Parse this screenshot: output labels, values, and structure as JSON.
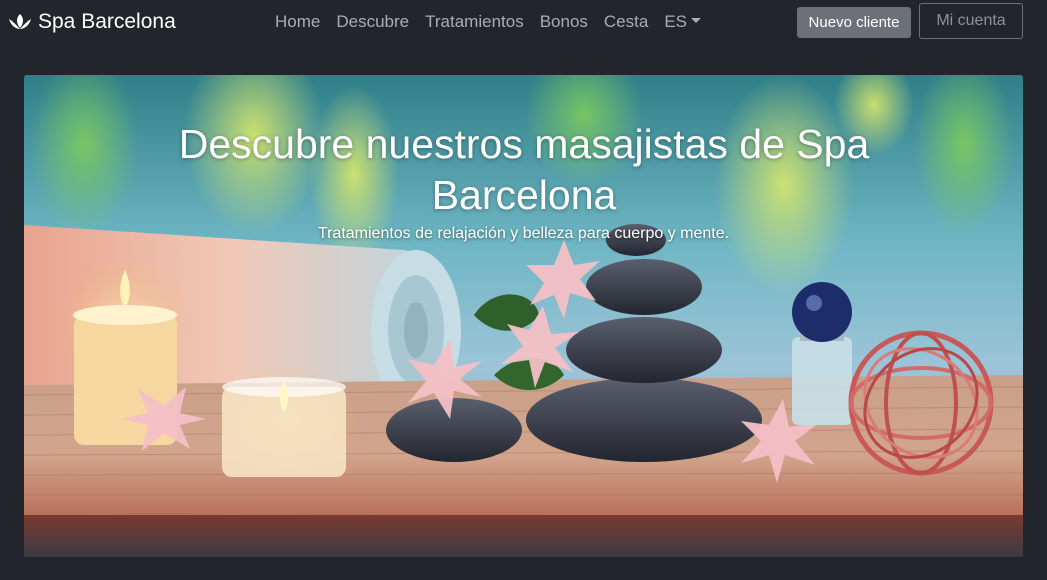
{
  "navbar": {
    "brand": "Spa Barcelona",
    "brand_icon": "lotus-icon",
    "links": [
      {
        "label": "Home"
      },
      {
        "label": "Descubre"
      },
      {
        "label": "Tratamientos"
      },
      {
        "label": "Bonos"
      },
      {
        "label": "Cesta"
      }
    ],
    "language": "ES",
    "new_client": "Nuevo cliente",
    "account": "Mi cuenta"
  },
  "hero": {
    "title": "Descubre nuestros masajistas de Spa Barcelona",
    "subtitle": "Tratamientos de relajación y belleza para cuerpo y mente."
  },
  "colors": {
    "background": "#22252b",
    "nav_text": "#a9acb1",
    "button_secondary": "#6c7077"
  }
}
